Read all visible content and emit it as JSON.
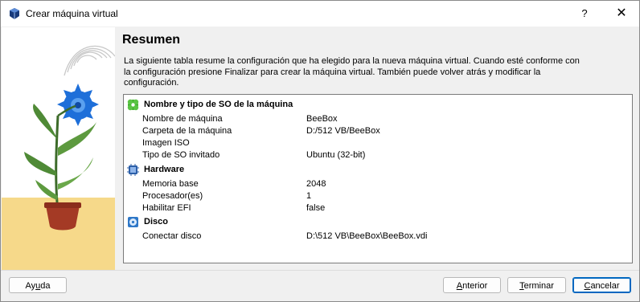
{
  "window": {
    "title": "Crear máquina virtual",
    "help_glyph": "?",
    "close_glyph": "✕"
  },
  "page": {
    "heading": "Resumen",
    "description": "La siguiente tabla resume la configuración que ha elegido para la nueva máquina virtual. Cuando esté conforme con la configuración presione Finalizar para crear la máquina virtual. También puede volver atrás y modificar la configuración."
  },
  "summary": {
    "sections": [
      {
        "title": "Nombre y tipo de SO de la máquina",
        "icon": "os-settings-icon",
        "rows": [
          {
            "key": "Nombre de máquina",
            "value": "BeeBox"
          },
          {
            "key": "Carpeta de la máquina",
            "value": "D:/512 VB/BeeBox"
          },
          {
            "key": "Imagen ISO",
            "value": ""
          },
          {
            "key": "Tipo de SO invitado",
            "value": "Ubuntu (32-bit)"
          }
        ]
      },
      {
        "title": "Hardware",
        "icon": "chip-icon",
        "rows": [
          {
            "key": "Memoria base",
            "value": "2048"
          },
          {
            "key": "Procesador(es)",
            "value": "1"
          },
          {
            "key": "Habilitar EFI",
            "value": "false"
          }
        ]
      },
      {
        "title": "Disco",
        "icon": "disk-icon",
        "rows": [
          {
            "key": "Conectar disco",
            "value": "D:\\512 VB\\BeeBox\\BeeBox.vdi"
          }
        ]
      }
    ]
  },
  "buttons": {
    "help": {
      "pre": "Ay",
      "acc": "u",
      "post": "da"
    },
    "back": {
      "pre": "",
      "acc": "A",
      "post": "nterior"
    },
    "finish": {
      "pre": "",
      "acc": "T",
      "post": "erminar"
    },
    "cancel": {
      "pre": "",
      "acc": "C",
      "post": "ancelar"
    }
  },
  "colors": {
    "accent": "#0067c0",
    "flower": "#1e6fd9",
    "sand": "#f6d98a"
  }
}
